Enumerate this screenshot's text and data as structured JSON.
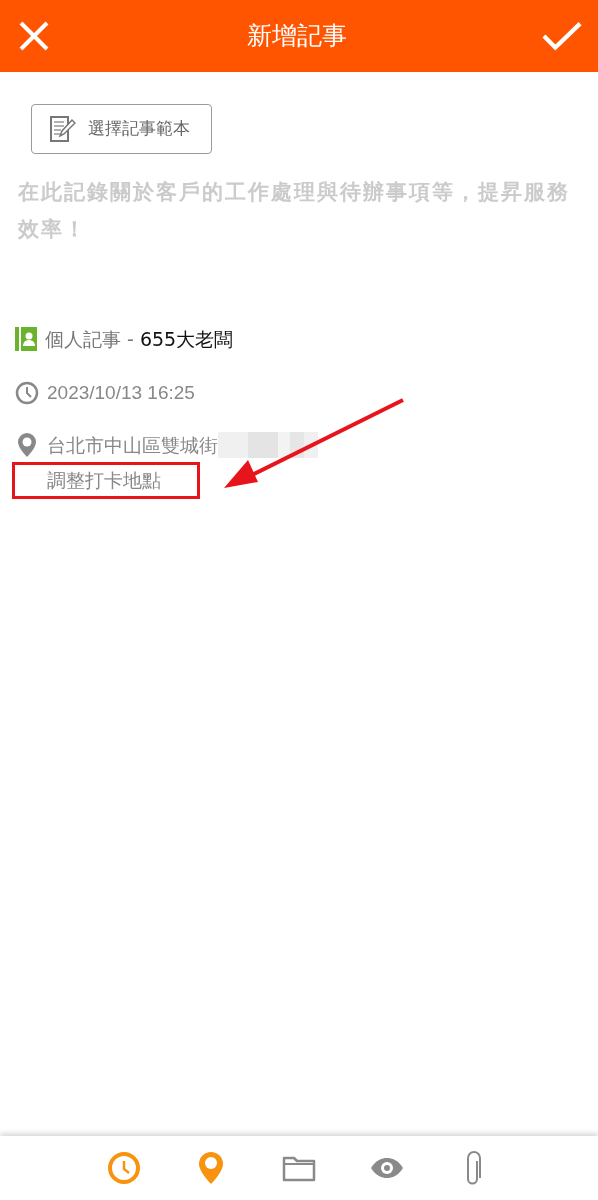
{
  "header": {
    "title": "新增記事"
  },
  "template_button": {
    "label": "選擇記事範本"
  },
  "note": {
    "placeholder": "在此記錄關於客戶的工作處理與待辦事項等，提昇服務效率！"
  },
  "category": {
    "type": "個人記事",
    "separator": " - ",
    "customer": "655大老闆"
  },
  "time": "2023/10/13 16:25",
  "location": {
    "address": "台北市中山區雙城街",
    "redacted": true,
    "adjust_link": "調整打卡地點",
    "highlighted": true
  },
  "toolbar": [
    {
      "kind": "clock",
      "active": true
    },
    {
      "kind": "pin",
      "active": true
    },
    {
      "kind": "folder",
      "active": false
    },
    {
      "kind": "eye",
      "active": false
    },
    {
      "kind": "clip",
      "active": false
    }
  ]
}
